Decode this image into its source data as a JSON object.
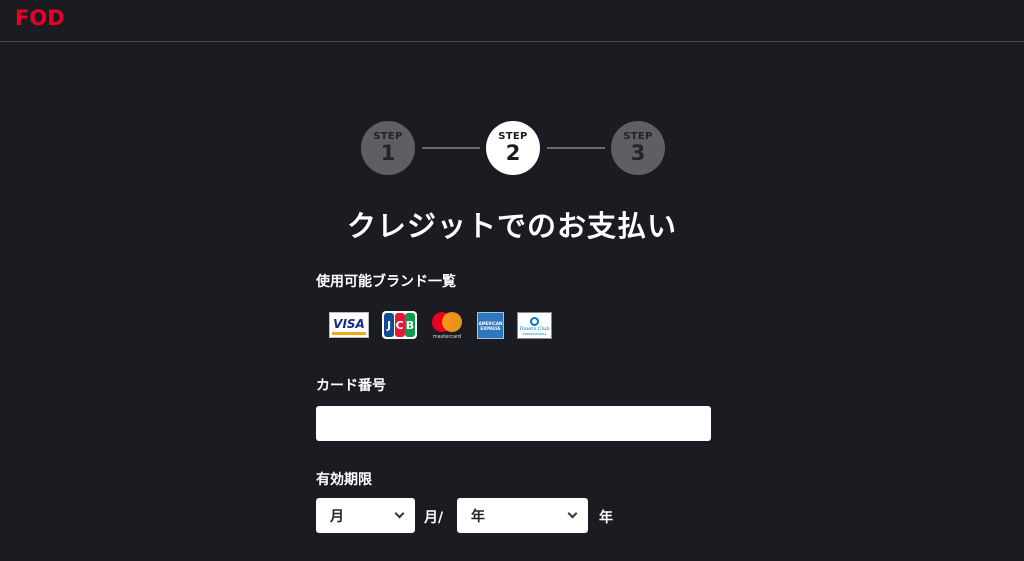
{
  "header": {
    "logo": "FOD"
  },
  "stepper": {
    "steps": [
      {
        "label": "STEP",
        "number": "1",
        "state": "inactive"
      },
      {
        "label": "STEP",
        "number": "2",
        "state": "active"
      },
      {
        "label": "STEP",
        "number": "3",
        "state": "inactive"
      }
    ]
  },
  "page": {
    "title": "クレジットでのお支払い"
  },
  "brands": {
    "label": "使用可能ブランド一覧",
    "items": [
      {
        "name": "visa",
        "text": "VISA"
      },
      {
        "name": "jcb",
        "text": [
          "J",
          "C",
          "B"
        ]
      },
      {
        "name": "mastercard",
        "text": "mastercard"
      },
      {
        "name": "amex",
        "text": "AMERICAN EXPRESS"
      },
      {
        "name": "diners",
        "text": "Diners Club",
        "sub": "INTERNATIONAL"
      }
    ]
  },
  "card_number": {
    "label": "カード番号",
    "value": "",
    "placeholder": ""
  },
  "expiry": {
    "label": "有効期限",
    "month_select": {
      "selected": "月"
    },
    "month_unit": "月/",
    "year_select": {
      "selected": "年"
    },
    "year_unit": "年"
  },
  "colors": {
    "background": "#1b1c21",
    "brand": "#e60027",
    "step_inactive": "#5e5f63",
    "step_active": "#ffffff"
  }
}
